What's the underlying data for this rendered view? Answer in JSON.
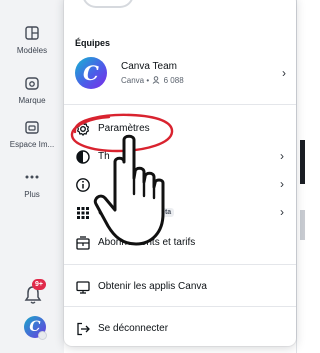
{
  "sidebar": {
    "items": [
      {
        "label": "Modèles",
        "icon": "template-icon"
      },
      {
        "label": "Marque",
        "icon": "brand-icon"
      },
      {
        "label": "Espace Im...",
        "icon": "folder-icon"
      },
      {
        "label": "Plus",
        "icon": "more-icon"
      }
    ],
    "notification_badge": "9+",
    "avatar_letter": "C"
  },
  "menu": {
    "section_title": "Équipes",
    "team": {
      "name": "Canva Team",
      "meta_prefix": "Canva •",
      "member_count": "6 088",
      "avatar_letter": "C"
    },
    "items": [
      {
        "label": "Paramètres",
        "icon": "settings-gear-icon",
        "chevron": false
      },
      {
        "label": "Th",
        "icon": "theme-icon",
        "chevron": true
      },
      {
        "label": "rces",
        "icon": "info-icon",
        "chevron": true
      },
      {
        "label": "Ou",
        "icon": "apps-grid-icon",
        "suffix": "s",
        "badge": "Bêta",
        "chevron": true
      },
      {
        "label": "Abonnements et tarifs",
        "icon": "subscription-icon",
        "chevron": false
      },
      {
        "label": "Obtenir les applis Canva",
        "icon": "desktop-icon",
        "chevron": false
      },
      {
        "label": "Se déconnecter",
        "icon": "logout-icon",
        "chevron": false
      }
    ]
  },
  "colors": {
    "annotation_circle": "#d9232f",
    "accent_gradient_start": "#16b5d0",
    "accent_gradient_end": "#7d2ae8",
    "badge": "#e02a4a"
  }
}
